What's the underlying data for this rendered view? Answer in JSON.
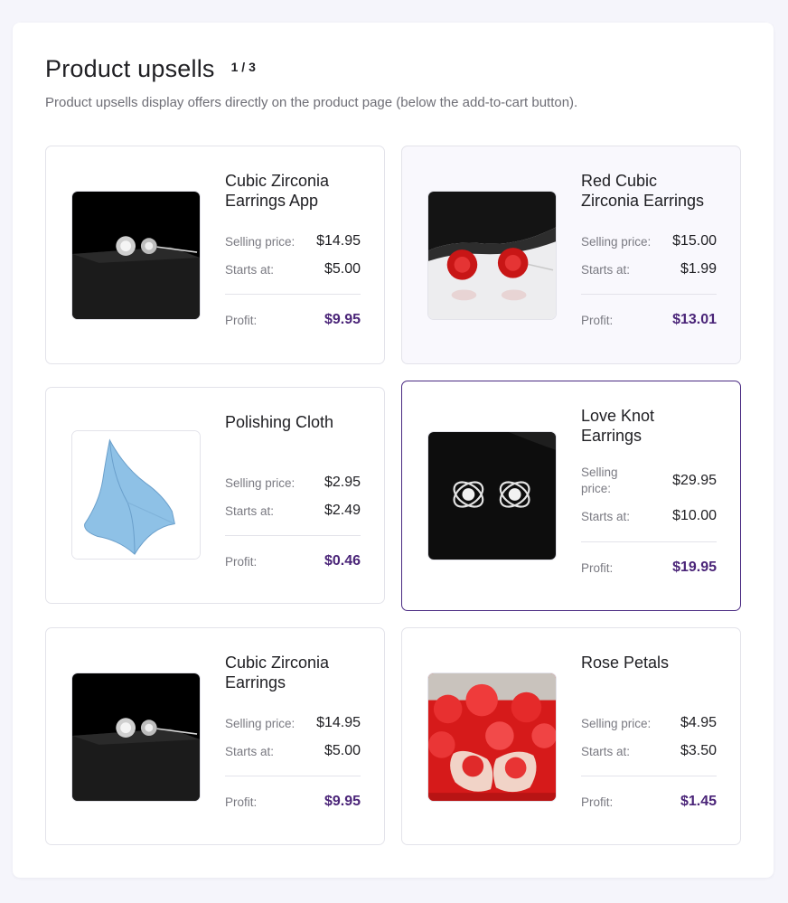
{
  "header": {
    "title": "Product upsells",
    "pager": "1 / 3",
    "subtitle": "Product upsells display offers directly on the product page (below the add-to-cart button)."
  },
  "labels": {
    "selling": "Selling price:",
    "starts": "Starts at:",
    "profit": "Profit:"
  },
  "products": [
    {
      "name": "Cubic Zirconia Earrings App",
      "image": "crystal-stud-earrings",
      "selling_price": "$14.95",
      "starts_at": "$5.00",
      "profit": "$9.95"
    },
    {
      "name": "Red Cubic Zirconia Earrings",
      "image": "red-stud-earrings",
      "selling_price": "$15.00",
      "starts_at": "$1.99",
      "profit": "$13.01"
    },
    {
      "name": "Polishing Cloth",
      "image": "blue-polishing-cloth",
      "selling_price": "$2.95",
      "starts_at": "$2.49",
      "profit": "$0.46"
    },
    {
      "name": "Love Knot Earrings",
      "image": "love-knot-earrings",
      "selling_price": "$29.95",
      "starts_at": "$10.00",
      "profit": "$19.95",
      "selected": true
    },
    {
      "name": "Cubic Zirconia Earrings",
      "image": "crystal-stud-earrings",
      "selling_price": "$14.95",
      "starts_at": "$5.00",
      "profit": "$9.95"
    },
    {
      "name": "Rose Petals",
      "image": "rose-petals",
      "selling_price": "$4.95",
      "starts_at": "$3.50",
      "profit": "$1.45"
    }
  ],
  "colors": {
    "accent": "#4a2478",
    "selected_border": "#4a2a82",
    "page_bg": "#f5f5fb"
  }
}
